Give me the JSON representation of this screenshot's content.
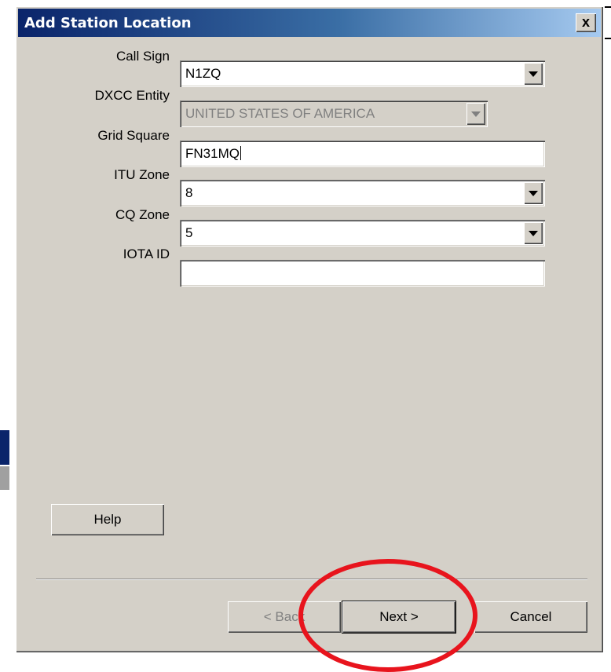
{
  "dialog": {
    "title": "Add Station Location",
    "close_glyph": "x"
  },
  "fields": {
    "call_sign": {
      "label": "Call Sign",
      "value": "N1ZQ"
    },
    "dxcc_entity": {
      "label": "DXCC Entity",
      "value": "UNITED STATES OF AMERICA"
    },
    "grid_square": {
      "label": "Grid Square",
      "value": "FN31MQ"
    },
    "itu_zone": {
      "label": "ITU Zone",
      "value": "8"
    },
    "cq_zone": {
      "label": "CQ Zone",
      "value": "5"
    },
    "iota_id": {
      "label": "IOTA ID",
      "value": ""
    }
  },
  "buttons": {
    "help": "Help",
    "back": "< Back",
    "next": "Next >",
    "cancel": "Cancel"
  },
  "annotation": {
    "color": "#e8141d"
  }
}
